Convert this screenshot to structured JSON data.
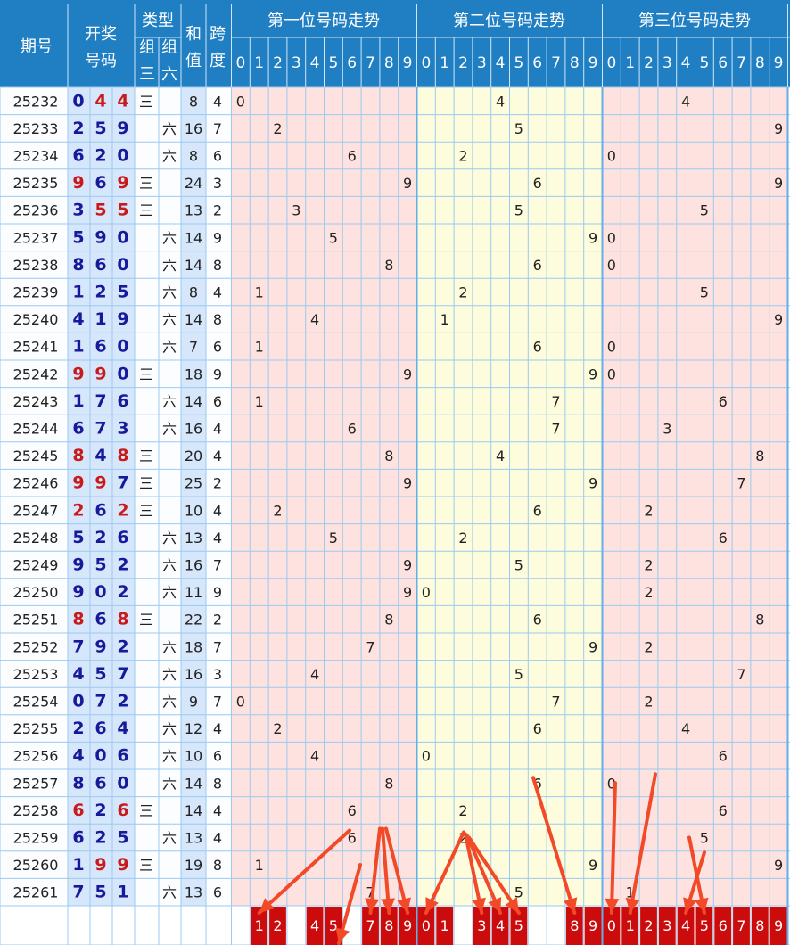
{
  "header": {
    "period": "期号",
    "open1": "开奖",
    "open2": "号码",
    "type": "类型",
    "z3a": "组",
    "z3b": "三",
    "z6a": "组",
    "z6b": "六",
    "suma": "和",
    "sumb": "值",
    "spana": "跨",
    "spanb": "度",
    "section_titles": [
      "第一位号码走势",
      "第二位号码走势",
      "第三位号码走势"
    ],
    "digits": [
      "0",
      "1",
      "2",
      "3",
      "4",
      "5",
      "6",
      "7",
      "8",
      "9"
    ]
  },
  "chart_data": {
    "type": "table",
    "rows": [
      {
        "period": "25232",
        "nums": [
          0,
          4,
          4
        ],
        "type": "三",
        "sum": 8,
        "span": 4
      },
      {
        "period": "25233",
        "nums": [
          2,
          5,
          9
        ],
        "type": "六",
        "sum": 16,
        "span": 7
      },
      {
        "period": "25234",
        "nums": [
          6,
          2,
          0
        ],
        "type": "六",
        "sum": 8,
        "span": 6
      },
      {
        "period": "25235",
        "nums": [
          9,
          6,
          9
        ],
        "type": "三",
        "sum": 24,
        "span": 3
      },
      {
        "period": "25236",
        "nums": [
          3,
          5,
          5
        ],
        "type": "三",
        "sum": 13,
        "span": 2
      },
      {
        "period": "25237",
        "nums": [
          5,
          9,
          0
        ],
        "type": "六",
        "sum": 14,
        "span": 9
      },
      {
        "period": "25238",
        "nums": [
          8,
          6,
          0
        ],
        "type": "六",
        "sum": 14,
        "span": 8
      },
      {
        "period": "25239",
        "nums": [
          1,
          2,
          5
        ],
        "type": "六",
        "sum": 8,
        "span": 4
      },
      {
        "period": "25240",
        "nums": [
          4,
          1,
          9
        ],
        "type": "六",
        "sum": 14,
        "span": 8
      },
      {
        "period": "25241",
        "nums": [
          1,
          6,
          0
        ],
        "type": "六",
        "sum": 7,
        "span": 6
      },
      {
        "period": "25242",
        "nums": [
          9,
          9,
          0
        ],
        "type": "三",
        "sum": 18,
        "span": 9
      },
      {
        "period": "25243",
        "nums": [
          1,
          7,
          6
        ],
        "type": "六",
        "sum": 14,
        "span": 6
      },
      {
        "period": "25244",
        "nums": [
          6,
          7,
          3
        ],
        "type": "六",
        "sum": 16,
        "span": 4
      },
      {
        "period": "25245",
        "nums": [
          8,
          4,
          8
        ],
        "type": "三",
        "sum": 20,
        "span": 4
      },
      {
        "period": "25246",
        "nums": [
          9,
          9,
          7
        ],
        "type": "三",
        "sum": 25,
        "span": 2
      },
      {
        "period": "25247",
        "nums": [
          2,
          6,
          2
        ],
        "type": "三",
        "sum": 10,
        "span": 4
      },
      {
        "period": "25248",
        "nums": [
          5,
          2,
          6
        ],
        "type": "六",
        "sum": 13,
        "span": 4
      },
      {
        "period": "25249",
        "nums": [
          9,
          5,
          2
        ],
        "type": "六",
        "sum": 16,
        "span": 7
      },
      {
        "period": "25250",
        "nums": [
          9,
          0,
          2
        ],
        "type": "六",
        "sum": 11,
        "span": 9
      },
      {
        "period": "25251",
        "nums": [
          8,
          6,
          8
        ],
        "type": "三",
        "sum": 22,
        "span": 2
      },
      {
        "period": "25252",
        "nums": [
          7,
          9,
          2
        ],
        "type": "六",
        "sum": 18,
        "span": 7
      },
      {
        "period": "25253",
        "nums": [
          4,
          5,
          7
        ],
        "type": "六",
        "sum": 16,
        "span": 3
      },
      {
        "period": "25254",
        "nums": [
          0,
          7,
          2
        ],
        "type": "六",
        "sum": 9,
        "span": 7
      },
      {
        "period": "25255",
        "nums": [
          2,
          6,
          4
        ],
        "type": "六",
        "sum": 12,
        "span": 4
      },
      {
        "period": "25256",
        "nums": [
          4,
          0,
          6
        ],
        "type": "六",
        "sum": 10,
        "span": 6
      },
      {
        "period": "25257",
        "nums": [
          8,
          6,
          0
        ],
        "type": "六",
        "sum": 14,
        "span": 8
      },
      {
        "period": "25258",
        "nums": [
          6,
          2,
          6
        ],
        "type": "三",
        "sum": 14,
        "span": 4
      },
      {
        "period": "25259",
        "nums": [
          6,
          2,
          5
        ],
        "type": "六",
        "sum": 13,
        "span": 4
      },
      {
        "period": "25260",
        "nums": [
          1,
          9,
          9
        ],
        "type": "三",
        "sum": 19,
        "span": 8
      },
      {
        "period": "25261",
        "nums": [
          7,
          5,
          1
        ],
        "type": "六",
        "sum": 13,
        "span": 6
      }
    ],
    "predictions": [
      [
        1,
        2,
        4,
        5,
        7,
        8,
        9
      ],
      [
        0,
        1,
        3,
        4,
        5,
        8,
        9
      ],
      [
        0,
        1,
        2,
        3,
        4,
        5,
        6,
        7,
        8,
        9
      ]
    ]
  },
  "colors": {
    "header_bg": "#1f7fc2",
    "grid": "#9ccaf0",
    "left_bg": "#fbfdff",
    "num_bg": "#d6e6fb",
    "sum_bg": "#d6e6fb",
    "sec1_bg": "#fde2df",
    "sec2_bg": "#fdfcdc",
    "sec3_bg": "#fde2df",
    "num_blue": "#16199a",
    "num_red": "#c81a1a",
    "pred_bg": "#cc0c0c",
    "arrow": "#f24a28"
  }
}
